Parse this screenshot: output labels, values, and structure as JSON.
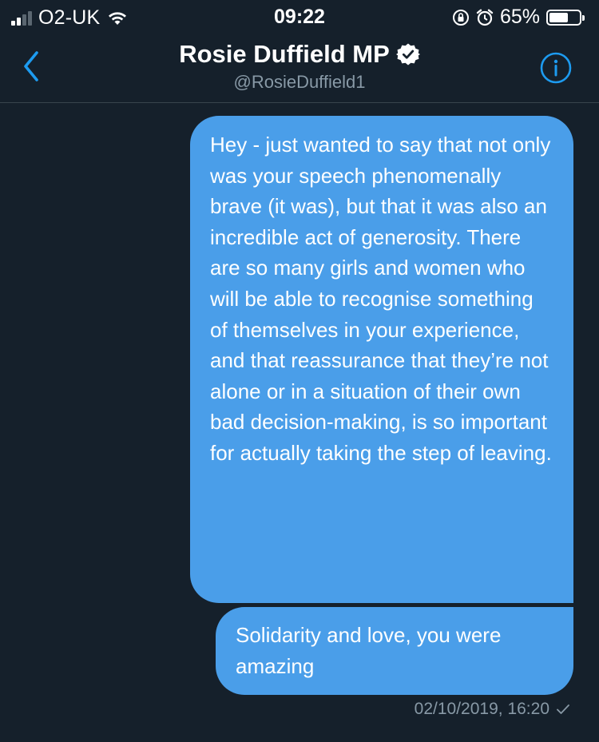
{
  "status_bar": {
    "carrier": "O2-UK",
    "time": "09:22",
    "battery_percent": "65%",
    "battery_level": 0.65,
    "signal_bars": 2,
    "icons": [
      "signal-icon",
      "wifi-icon",
      "orientation-lock-icon",
      "alarm-icon",
      "battery-icon"
    ]
  },
  "header": {
    "name": "Rosie Duffield MP",
    "handle": "@RosieDuffield1",
    "verified": true,
    "icons": [
      "back-chevron-icon",
      "verified-badge-icon",
      "info-icon"
    ]
  },
  "messages": [
    {
      "text": "Hey - just wanted to say that not only was your speech phenomenally brave (it was), but that it was also an incredible act of generosity. There are so many girls and women who will be able to recognise something of themselves in your experience, and that reassurance that they’re not alone or in a situation of their own bad decision-making, is so important for actually taking the step of leaving."
    },
    {
      "text": "Solidarity and love, you were amazing"
    }
  ],
  "timestamp": "02/10/2019, 16:20",
  "colors": {
    "background": "#15202b",
    "bubble": "#4a9ee9",
    "accent": "#1d9bf0",
    "muted": "#8899a6"
  }
}
